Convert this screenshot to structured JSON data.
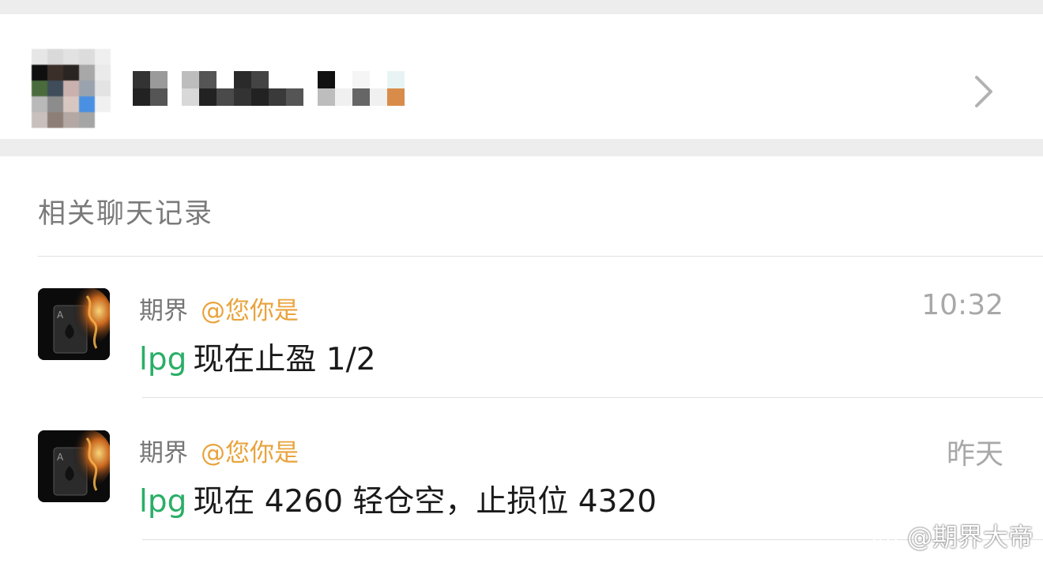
{
  "group": {
    "name_redacted": true
  },
  "section": {
    "title": "相关聊天记录"
  },
  "messages": [
    {
      "sender": "期界",
      "mention": "@您你是",
      "time": "10:32",
      "keyword": "lpg",
      "text": "现在止盈 1/2"
    },
    {
      "sender": "期界",
      "mention": "@您你是",
      "time": "昨天",
      "keyword": "lpg",
      "text": "现在 4260 轻仓空，止损位 4320"
    }
  ],
  "watermark": {
    "text": "@期界大帝"
  },
  "colors": {
    "keyword": "#2aae67",
    "mention": "#e8a33c",
    "time": "#a8a8a8",
    "background": "#ededed"
  }
}
